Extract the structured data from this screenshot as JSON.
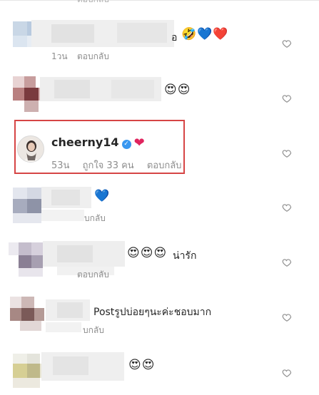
{
  "top_fragment": "ตอบกลับ",
  "comments": [
    {
      "id": "c1",
      "suffix": "อ",
      "emojis": "🤣💙❤️",
      "meta": "ตอบกลับ",
      "time": "1วน"
    },
    {
      "id": "c2",
      "emojis": "😍😍"
    },
    {
      "id": "c3",
      "username": "cheerny14",
      "verified": "✓",
      "emoji": "❤",
      "time": "53น",
      "likes": "ถูกใจ 33 คน",
      "reply": "ตอบกลับ"
    },
    {
      "id": "c4",
      "emojis": "💙",
      "meta": "บกลับ"
    },
    {
      "id": "c5",
      "emojis": "😍😍😍",
      "text": "น่ารัก",
      "meta": "ตอบกลับ"
    },
    {
      "id": "c6",
      "text": "Postรูปบ่อยๆนะค่ะชอบมาก",
      "meta": "บกลับ"
    },
    {
      "id": "c7",
      "emojis": "😍😍"
    }
  ],
  "icons": {
    "like": "heart-outline-icon"
  },
  "colors": {
    "highlight_border": "#d64545",
    "verified": "#3897f0",
    "heart": "#e0245e",
    "meta": "#8e8e8e"
  }
}
